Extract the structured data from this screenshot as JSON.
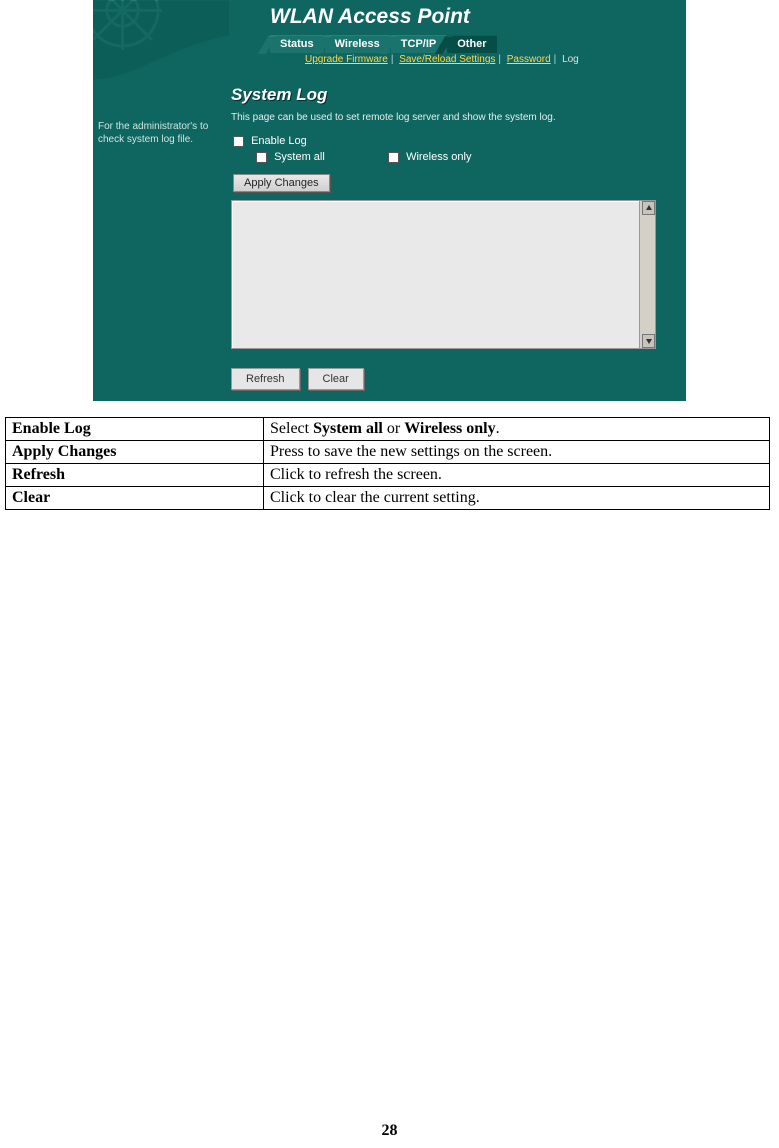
{
  "screenshot": {
    "header_title": "WLAN Access Point",
    "tabs": [
      "Status",
      "Wireless",
      "TCP/IP",
      "Other"
    ],
    "subnav": {
      "links": [
        "Upgrade Firmware",
        "Save/Reload Settings",
        "Password"
      ],
      "current": "Log"
    },
    "sidebar_text": "For the administrator's to check system log file.",
    "section_title": "System Log",
    "section_desc": "This page can be used to set remote log server and show the system log.",
    "enable_label": "Enable Log",
    "system_label": "System all",
    "wireless_label": "Wireless only",
    "apply_label": "Apply Changes",
    "refresh_label": "Refresh",
    "clear_label": "Clear"
  },
  "table": {
    "rows": [
      {
        "term": "Enable Log",
        "desc_pre": "Select ",
        "desc_b1": "System all",
        "desc_mid": " or ",
        "desc_b2": "Wireless only",
        "desc_post": "."
      },
      {
        "term": "Apply Changes",
        "desc": "Press to save the new settings on the screen."
      },
      {
        "term": "Refresh",
        "desc": "Click to refresh the screen."
      },
      {
        "term": "Clear",
        "desc": "Click to clear the current setting."
      }
    ]
  },
  "page_number": "28"
}
